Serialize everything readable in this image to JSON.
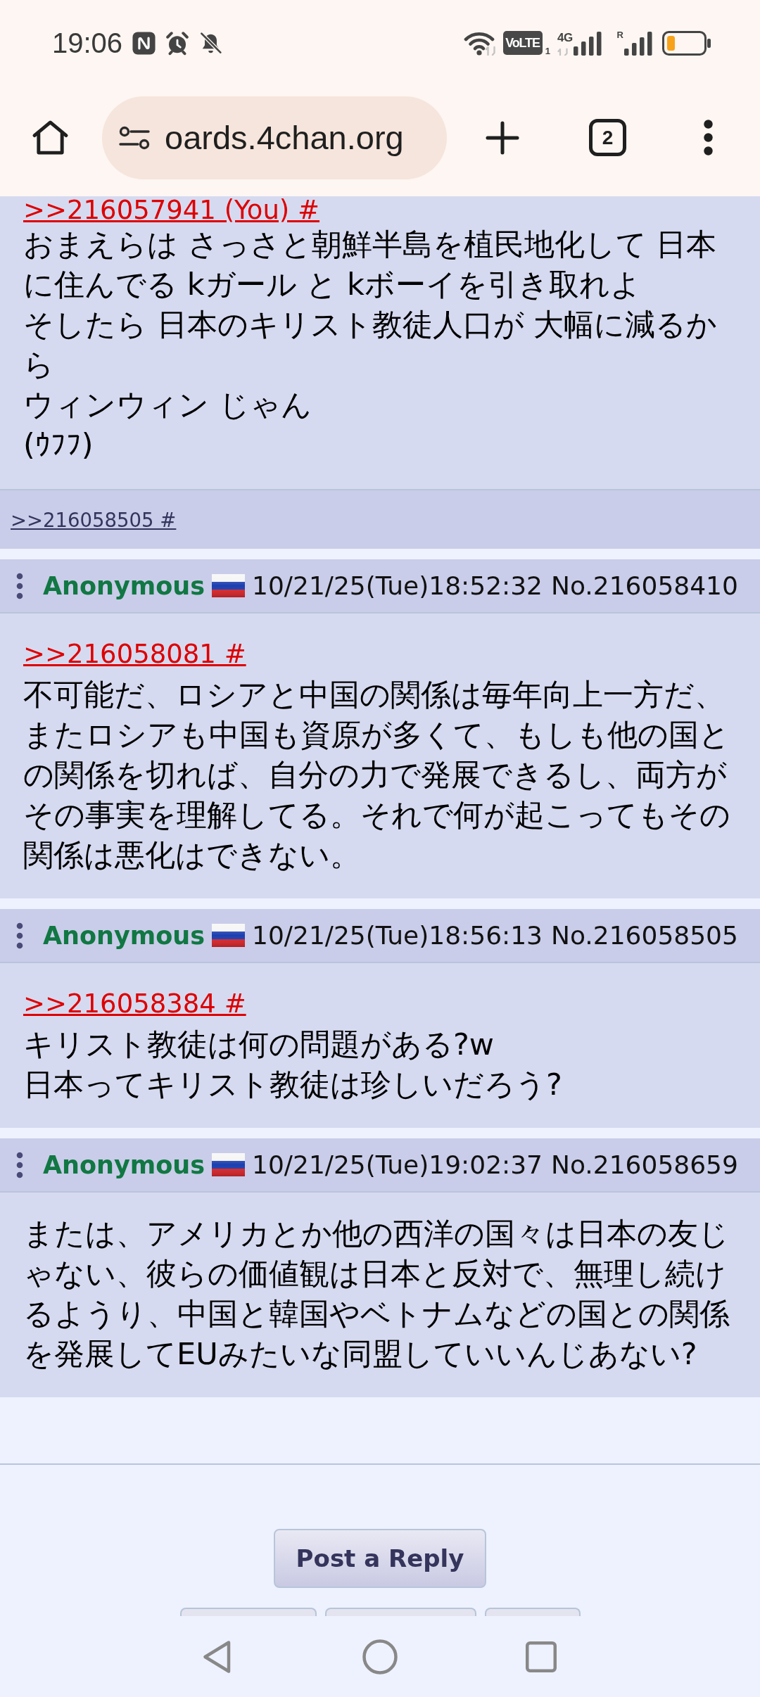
{
  "status_bar": {
    "time": "19:06",
    "volte_label": "VoLTE",
    "sim_slot": "1",
    "network_type": "4G",
    "roaming_mark": "R"
  },
  "browser_toolbar": {
    "url": "oards.4chan.org",
    "tab_count": "2"
  },
  "posts": [
    {
      "quote_link": ">>216057941 (You) #",
      "lines": [
        "おまえらは さっさと朝鮮半島を植民地化して 日本に住んでる kガール と kボーイを引き取れよ",
        "そしたら 日本のキリスト教徒人口が 大幅に減るから",
        "ウィンウィン じゃん",
        "(ｳﾌﾌ)"
      ],
      "backlinks": [
        ">>216058505 #"
      ]
    },
    {
      "author": "Anonymous",
      "datetime": "10/21/25(Tue)18:52:32",
      "post_number": "No.216058410",
      "quote_link": ">>216058081 #",
      "lines": [
        "不可能だ、ロシアと中国の関係は毎年向上一方だ、またロシアも中国も資原が多くて、もしも他の国との関係を切れば、自分の力で発展できるし、両方がその事実を理解してる。それで何が起こってもその関係は悪化はできない。"
      ]
    },
    {
      "author": "Anonymous",
      "datetime": "10/21/25(Tue)18:56:13",
      "post_number": "No.216058505",
      "quote_link": ">>216058384 #",
      "lines": [
        "キリスト教徒は何の問題がある?w",
        "日本ってキリスト教徒は珍しいだろう?"
      ]
    },
    {
      "author": "Anonymous",
      "datetime": "10/21/25(Tue)19:02:37",
      "post_number": "No.216058659",
      "lines": [
        "または、アメリカとか他の西洋の国々は日本の友じゃない、彼らの価値観は日本と反対で、無理し続けるようり、中国と韓国やベトナムなどの国との関係を発展してEUみたいな同盟していいんじあない?"
      ]
    }
  ],
  "post_reply_button": "Post a Reply"
}
